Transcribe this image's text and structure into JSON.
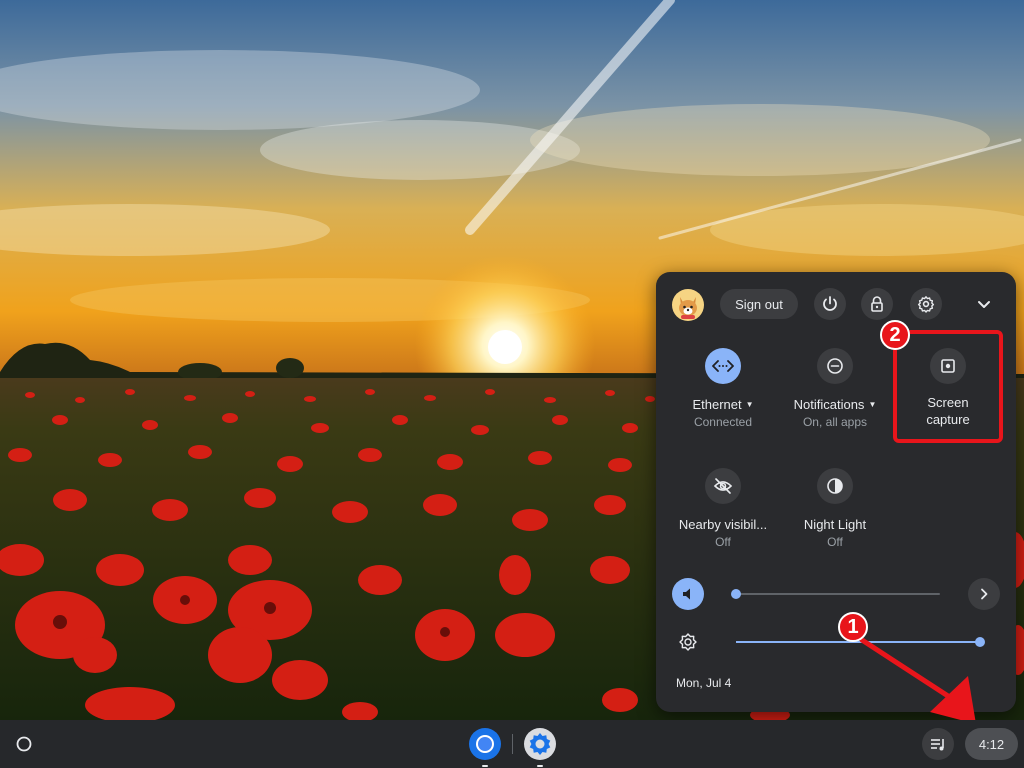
{
  "system_tray": {
    "user_avatar": "corgi-avatar",
    "sign_out_label": "Sign out",
    "header_icons": [
      "power-icon",
      "lock-icon",
      "settings-icon",
      "chevron-down-icon"
    ],
    "tiles": [
      {
        "label": "Ethernet",
        "sublabel": "Connected",
        "icon": "ethernet-icon",
        "active": true,
        "has_dropdown": true
      },
      {
        "label": "Notifications",
        "sublabel": "On, all apps",
        "icon": "do-not-disturb-icon",
        "active": false,
        "has_dropdown": true
      },
      {
        "label_line1": "Screen",
        "label_line2": "capture",
        "icon": "screen-capture-icon",
        "active": false
      },
      {
        "label": "Nearby visibil...",
        "sublabel": "Off",
        "icon": "nearby-visibility-off-icon",
        "active": false
      },
      {
        "label": "Night Light",
        "sublabel": "Off",
        "icon": "night-light-icon",
        "active": false
      }
    ],
    "volume_level": 0.0,
    "brightness_level": 1.0,
    "date": "Mon, Jul 4"
  },
  "annotations": {
    "step_1": "1",
    "step_2": "2",
    "color": "#e8151b"
  },
  "shelf": {
    "launcher_icon": "launcher-icon",
    "pinned_apps": [
      "chrome-icon",
      "settings-app-icon"
    ],
    "media_icon": "media-controls-icon",
    "clock": "4:12"
  },
  "colors": {
    "panel_bg": "#292a2d",
    "accent": "#8ab4f8",
    "shelf_bg": "#26282b"
  }
}
